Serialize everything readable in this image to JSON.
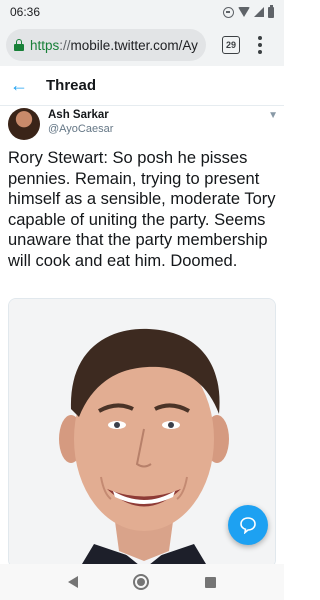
{
  "status_bar": {
    "time": "06:36",
    "icons": [
      "do-not-disturb-icon",
      "wifi-icon",
      "signal-icon",
      "battery-icon"
    ]
  },
  "browser": {
    "url_scheme": "https",
    "url_separator": "://",
    "url_host": "mobile.twitter.com/Ay",
    "tab_count": "29",
    "icons": [
      "lock-icon",
      "tabs-icon",
      "overflow-menu-icon"
    ]
  },
  "header": {
    "title": "Thread",
    "icons": [
      "back-arrow-icon"
    ]
  },
  "tweet": {
    "author_name": "Ash Sarkar",
    "author_handle": "@AyoCaesar",
    "text": "Rory Stewart: So posh he pisses pennies. Remain, trying to present himself as a sensible, moderate Tory capable of uniting the party. Seems unaware that the party membership will cook and eat him. Doomed.",
    "icons": [
      "chevron-down-icon"
    ]
  },
  "fab": {
    "icons": [
      "compose-reply-icon"
    ]
  },
  "nav_bar": {
    "icons": [
      "back-icon",
      "home-icon",
      "recents-icon"
    ]
  },
  "colors": {
    "accent": "#1da1f2",
    "secure_green": "#188038",
    "text_primary": "#14171a",
    "text_secondary": "#657786",
    "divider": "#e6ecf0"
  }
}
